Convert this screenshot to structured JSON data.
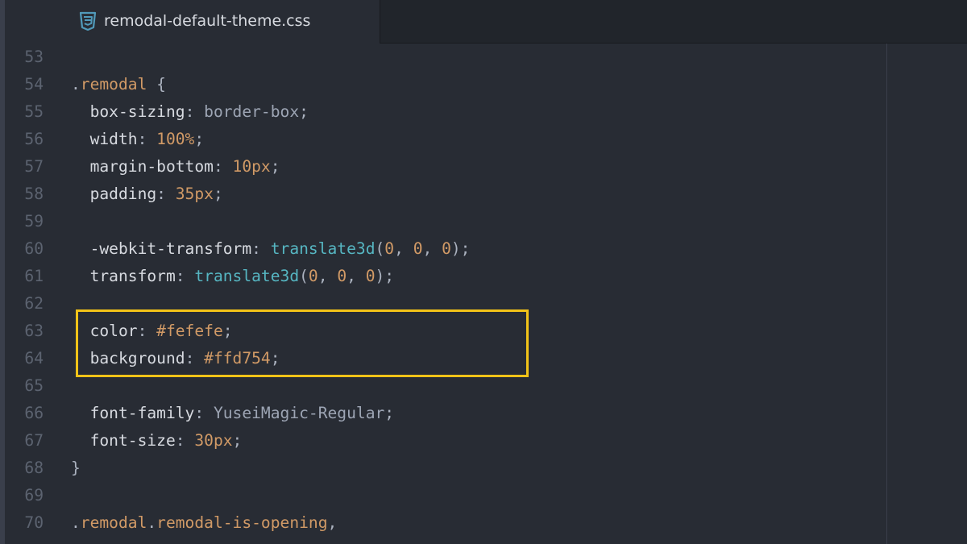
{
  "tab": {
    "title": "remodal-default-theme.css",
    "icon": "css3-file-icon"
  },
  "highlight_color": "#f2c318",
  "lines": [
    {
      "num": "53",
      "code": ""
    },
    {
      "num": "54",
      "code": ".remodal {"
    },
    {
      "num": "55",
      "code": "  box-sizing: border-box;"
    },
    {
      "num": "56",
      "code": "  width: 100%;"
    },
    {
      "num": "57",
      "code": "  margin-bottom: 10px;"
    },
    {
      "num": "58",
      "code": "  padding: 35px;"
    },
    {
      "num": "59",
      "code": ""
    },
    {
      "num": "60",
      "code": "  -webkit-transform: translate3d(0, 0, 0);"
    },
    {
      "num": "61",
      "code": "  transform: translate3d(0, 0, 0);"
    },
    {
      "num": "62",
      "code": ""
    },
    {
      "num": "63",
      "code": "  color: #fefefe;"
    },
    {
      "num": "64",
      "code": "  background: #ffd754;"
    },
    {
      "num": "65",
      "code": ""
    },
    {
      "num": "66",
      "code": "  font-family: YuseiMagic-Regular;"
    },
    {
      "num": "67",
      "code": "  font-size: 30px;"
    },
    {
      "num": "68",
      "code": "}"
    },
    {
      "num": "69",
      "code": ""
    },
    {
      "num": "70",
      "code": ".remodal.remodal-is-opening,"
    }
  ]
}
